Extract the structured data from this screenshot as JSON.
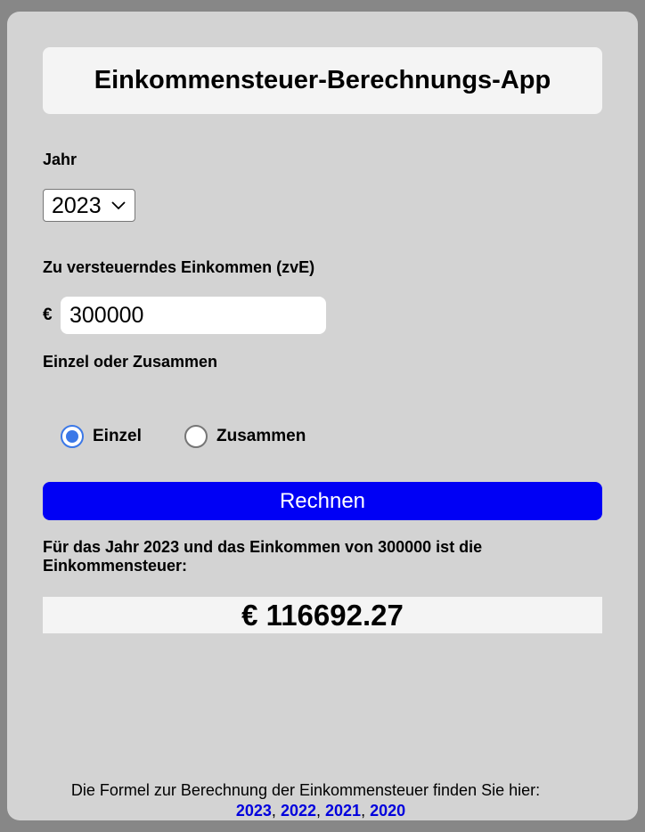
{
  "app": {
    "title": "Einkommensteuer-Berechnungs-App"
  },
  "year": {
    "label": "Jahr",
    "selected": "2023",
    "options": [
      "2023"
    ]
  },
  "income": {
    "label": "Zu versteuerndes Einkommen (zvE)",
    "currency": "€",
    "value": "300000"
  },
  "filing": {
    "label": "Einzel oder Zusammen",
    "options": [
      {
        "label": "Einzel",
        "checked": true
      },
      {
        "label": "Zusammen",
        "checked": false
      }
    ]
  },
  "button": {
    "label": "Rechnen"
  },
  "result": {
    "text": "Für das Jahr 2023 und das Einkommen von 300000 ist die Einkommensteuer:",
    "amount": "€ 116692.27"
  },
  "footer": {
    "text": "Die Formel zur Berechnung der Einkommensteuer finden Sie hier:",
    "links": [
      "2023",
      "2022",
      "2021",
      "2020"
    ],
    "separator": ","
  },
  "colors": {
    "accent": "#0000f5",
    "link": "#0000dd",
    "radio": "#3b78e7",
    "card": "#d3d3d3",
    "background": "#878787"
  }
}
